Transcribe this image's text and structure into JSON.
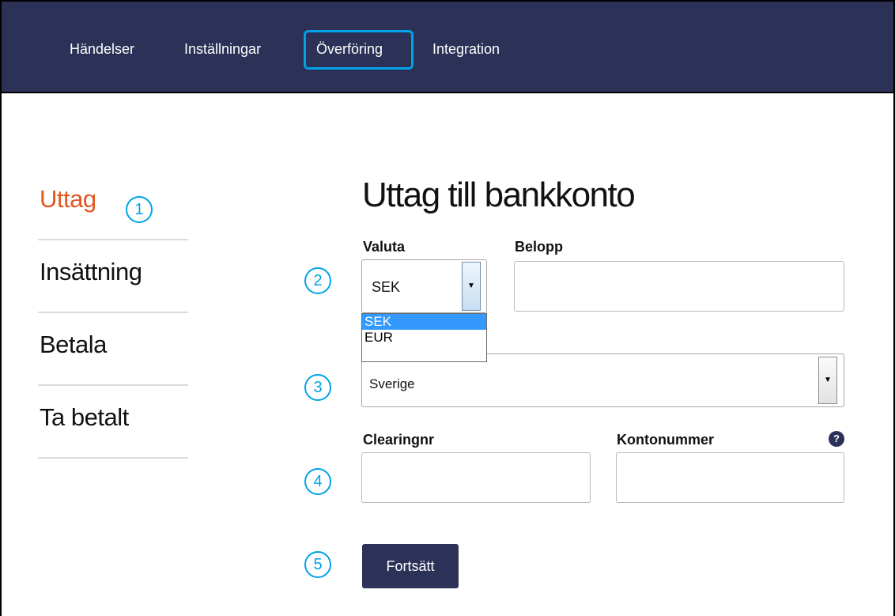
{
  "nav": {
    "items": [
      {
        "label": "Händelser"
      },
      {
        "label": "Inställningar"
      },
      {
        "label": "Överföring"
      },
      {
        "label": "Integration"
      }
    ],
    "active_index": 2
  },
  "sidebar": {
    "items": [
      {
        "label": "Uttag",
        "active": true
      },
      {
        "label": "Insättning"
      },
      {
        "label": "Betala"
      },
      {
        "label": "Ta betalt"
      }
    ]
  },
  "markers": [
    "1",
    "2",
    "3",
    "4",
    "5"
  ],
  "form": {
    "title": "Uttag till bankkonto",
    "currency": {
      "label": "Valuta",
      "value": "SEK",
      "options": [
        "SEK",
        "EUR"
      ],
      "highlighted_option": "SEK"
    },
    "amount": {
      "label": "Belopp",
      "value": ""
    },
    "country": {
      "value": "Sverige"
    },
    "clearing": {
      "label": "Clearingnr",
      "value": ""
    },
    "account": {
      "label": "Kontonummer",
      "value": "",
      "help": "?"
    },
    "submit_label": "Fortsätt"
  },
  "colors": {
    "nav_bg": "#2b3157",
    "accent": "#e0571f",
    "annotation": "#00a2e8",
    "button_bg": "#2b3157",
    "option_highlight": "#3399ff"
  }
}
